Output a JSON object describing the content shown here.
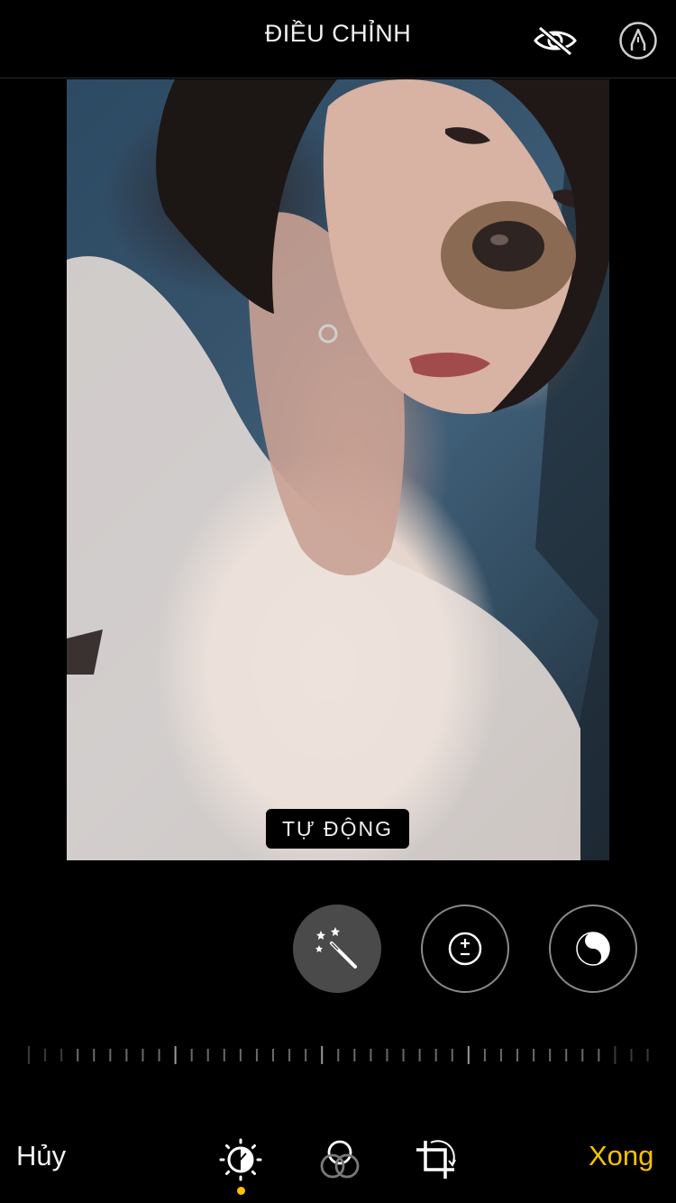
{
  "header": {
    "title": "ĐIỀU CHỈNH",
    "hide_icon": "eye-slash-icon",
    "markup_icon": "markup-pen-icon"
  },
  "photo": {
    "description_icon": "photo-preview",
    "mode_badge": "TỰ ĐỘNG"
  },
  "adjust_tools": [
    {
      "name": "auto",
      "icon": "magic-wand-icon",
      "selected": true
    },
    {
      "name": "exposure",
      "icon": "exposure-plus-minus-icon",
      "selected": false
    },
    {
      "name": "brilliance",
      "icon": "yin-yang-icon",
      "selected": false
    }
  ],
  "bottom_bar": {
    "cancel_label": "Hủy",
    "done_label": "Xong",
    "tabs": [
      {
        "icon": "adjust-dial-icon",
        "active": true
      },
      {
        "icon": "filters-icon",
        "active": false
      },
      {
        "icon": "crop-rotate-icon",
        "active": false
      }
    ]
  },
  "colors": {
    "accent": "#f7c300",
    "background": "#000000",
    "selected_tool_bg": "#4a4a4a"
  }
}
